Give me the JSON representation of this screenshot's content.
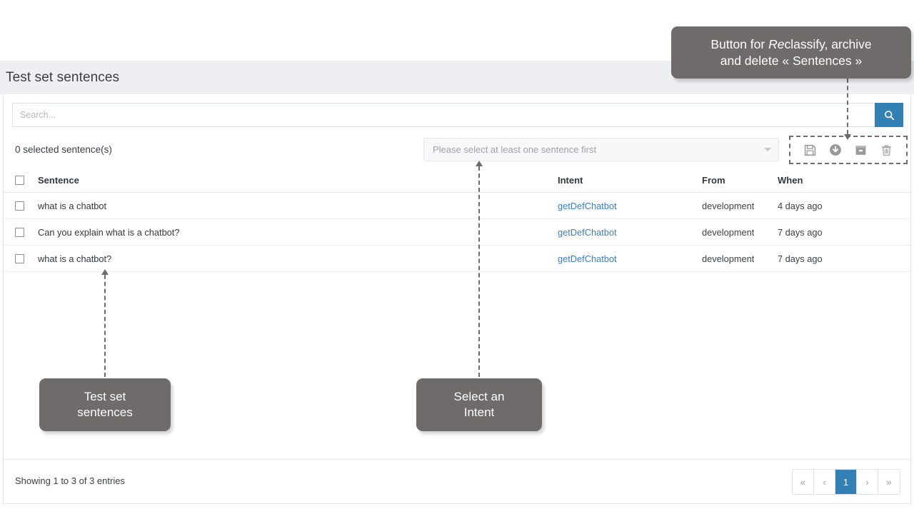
{
  "header": {
    "title": "Test set sentences"
  },
  "search": {
    "placeholder": "Search...",
    "value": "",
    "button_icon": "search-icon"
  },
  "actionbar": {
    "selected_text": "0 selected sentence(s)",
    "intent_select_placeholder": "Please select at least one sentence first",
    "icons": [
      {
        "name": "save-icon",
        "glyph": "save"
      },
      {
        "name": "reclassify-icon",
        "glyph": "circle-arrow-down"
      },
      {
        "name": "archive-icon",
        "glyph": "archive"
      },
      {
        "name": "delete-icon",
        "glyph": "trash"
      }
    ]
  },
  "table": {
    "columns": [
      "Sentence",
      "Intent",
      "From",
      "When"
    ],
    "rows": [
      {
        "sentence": "what is a chatbot",
        "intent": "getDefChatbot",
        "from": "development",
        "when": "4 days ago"
      },
      {
        "sentence": "Can you explain what is a chatbot?",
        "intent": "getDefChatbot",
        "from": "development",
        "when": "7 days ago"
      },
      {
        "sentence": "what is a chatbot?",
        "intent": "getDefChatbot",
        "from": "development",
        "when": "7 days ago"
      }
    ]
  },
  "footer": {
    "showing": "Showing 1 to 3 of 3 entries",
    "pagination": {
      "first": "«",
      "prev": "‹",
      "pages": [
        "1"
      ],
      "next": "›",
      "last": "»",
      "active": "1"
    }
  },
  "annotations": {
    "reclassify": {
      "line1_pre": "Button for ",
      "line1_em": "Re",
      "line1_post": "classify, archive",
      "line2": "and delete « Sentences »"
    },
    "testset": {
      "text": "Test set\nsentences"
    },
    "intent": {
      "text": "Select an\nIntent"
    }
  },
  "colors": {
    "accent": "#3380b5",
    "header_band": "#edeff2",
    "callout": "#6e6b6a",
    "link": "#3b7fbf"
  }
}
